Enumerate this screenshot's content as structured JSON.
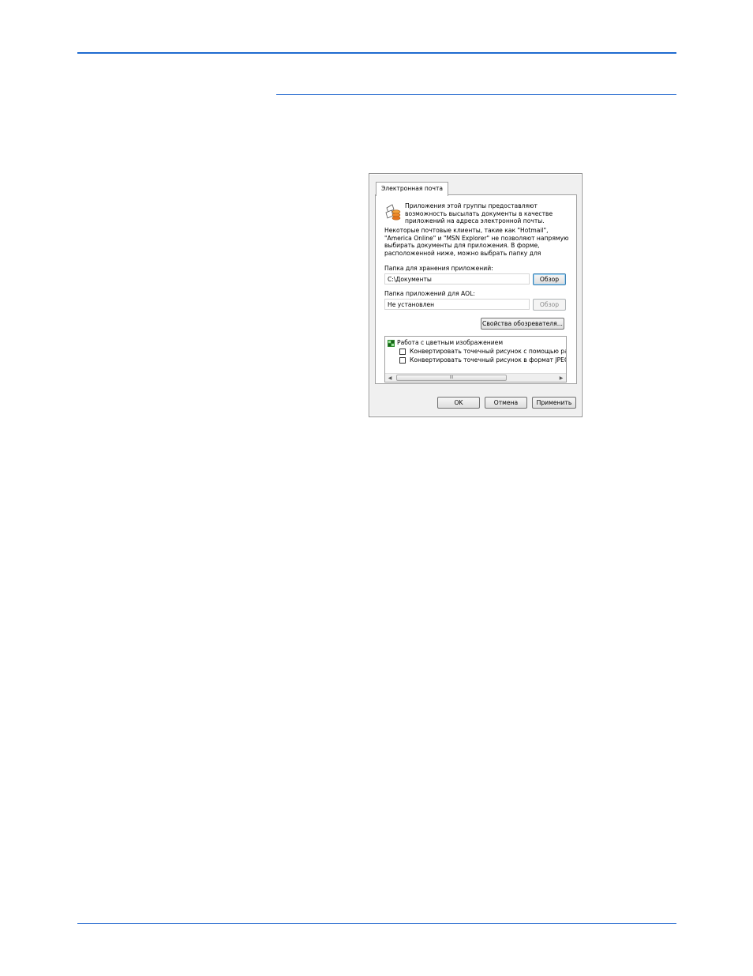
{
  "dialog": {
    "tab_label": "Электронная почта",
    "intro_text": "Приложения этой группы предоставляют возможность высылать документы в качестве приложений на адреса электронной почты.",
    "note_text": "Некоторые почтовые клиенты, такие как \"Hotmail\", \"America Online\" и \"MSN Explorer\" не позволяют напрямую выбирать документы для приложения. В форме, расположенной ниже, можно выбрать папку для",
    "attachments_folder": {
      "label": "Папка для хранения приложений:",
      "value": "C:\\Документы",
      "browse_label": "Обзор"
    },
    "aol_folder": {
      "label": "Папка приложений для AOL:",
      "value": "Не установлен",
      "browse_label": "Обзор"
    },
    "browser_properties_label": "Свойства обозревателя...",
    "options": {
      "group_label": "Работа с цветным изображением",
      "items": [
        {
          "label": "Конвертировать точечный рисунок с помощью раз",
          "checked": false
        },
        {
          "label": "Конвертировать точечный рисунок в формат JPEG",
          "checked": false
        }
      ],
      "scroll_thumb_glyph": "III",
      "scroll_left_icon": "scroll-left-arrow",
      "scroll_right_icon": "scroll-right-arrow"
    },
    "buttons": {
      "ok": "OK",
      "cancel": "Отмена",
      "apply": "Применить"
    }
  },
  "colors": {
    "rule": "#1f6bd0",
    "dialog_bg": "#f0f0f0"
  }
}
